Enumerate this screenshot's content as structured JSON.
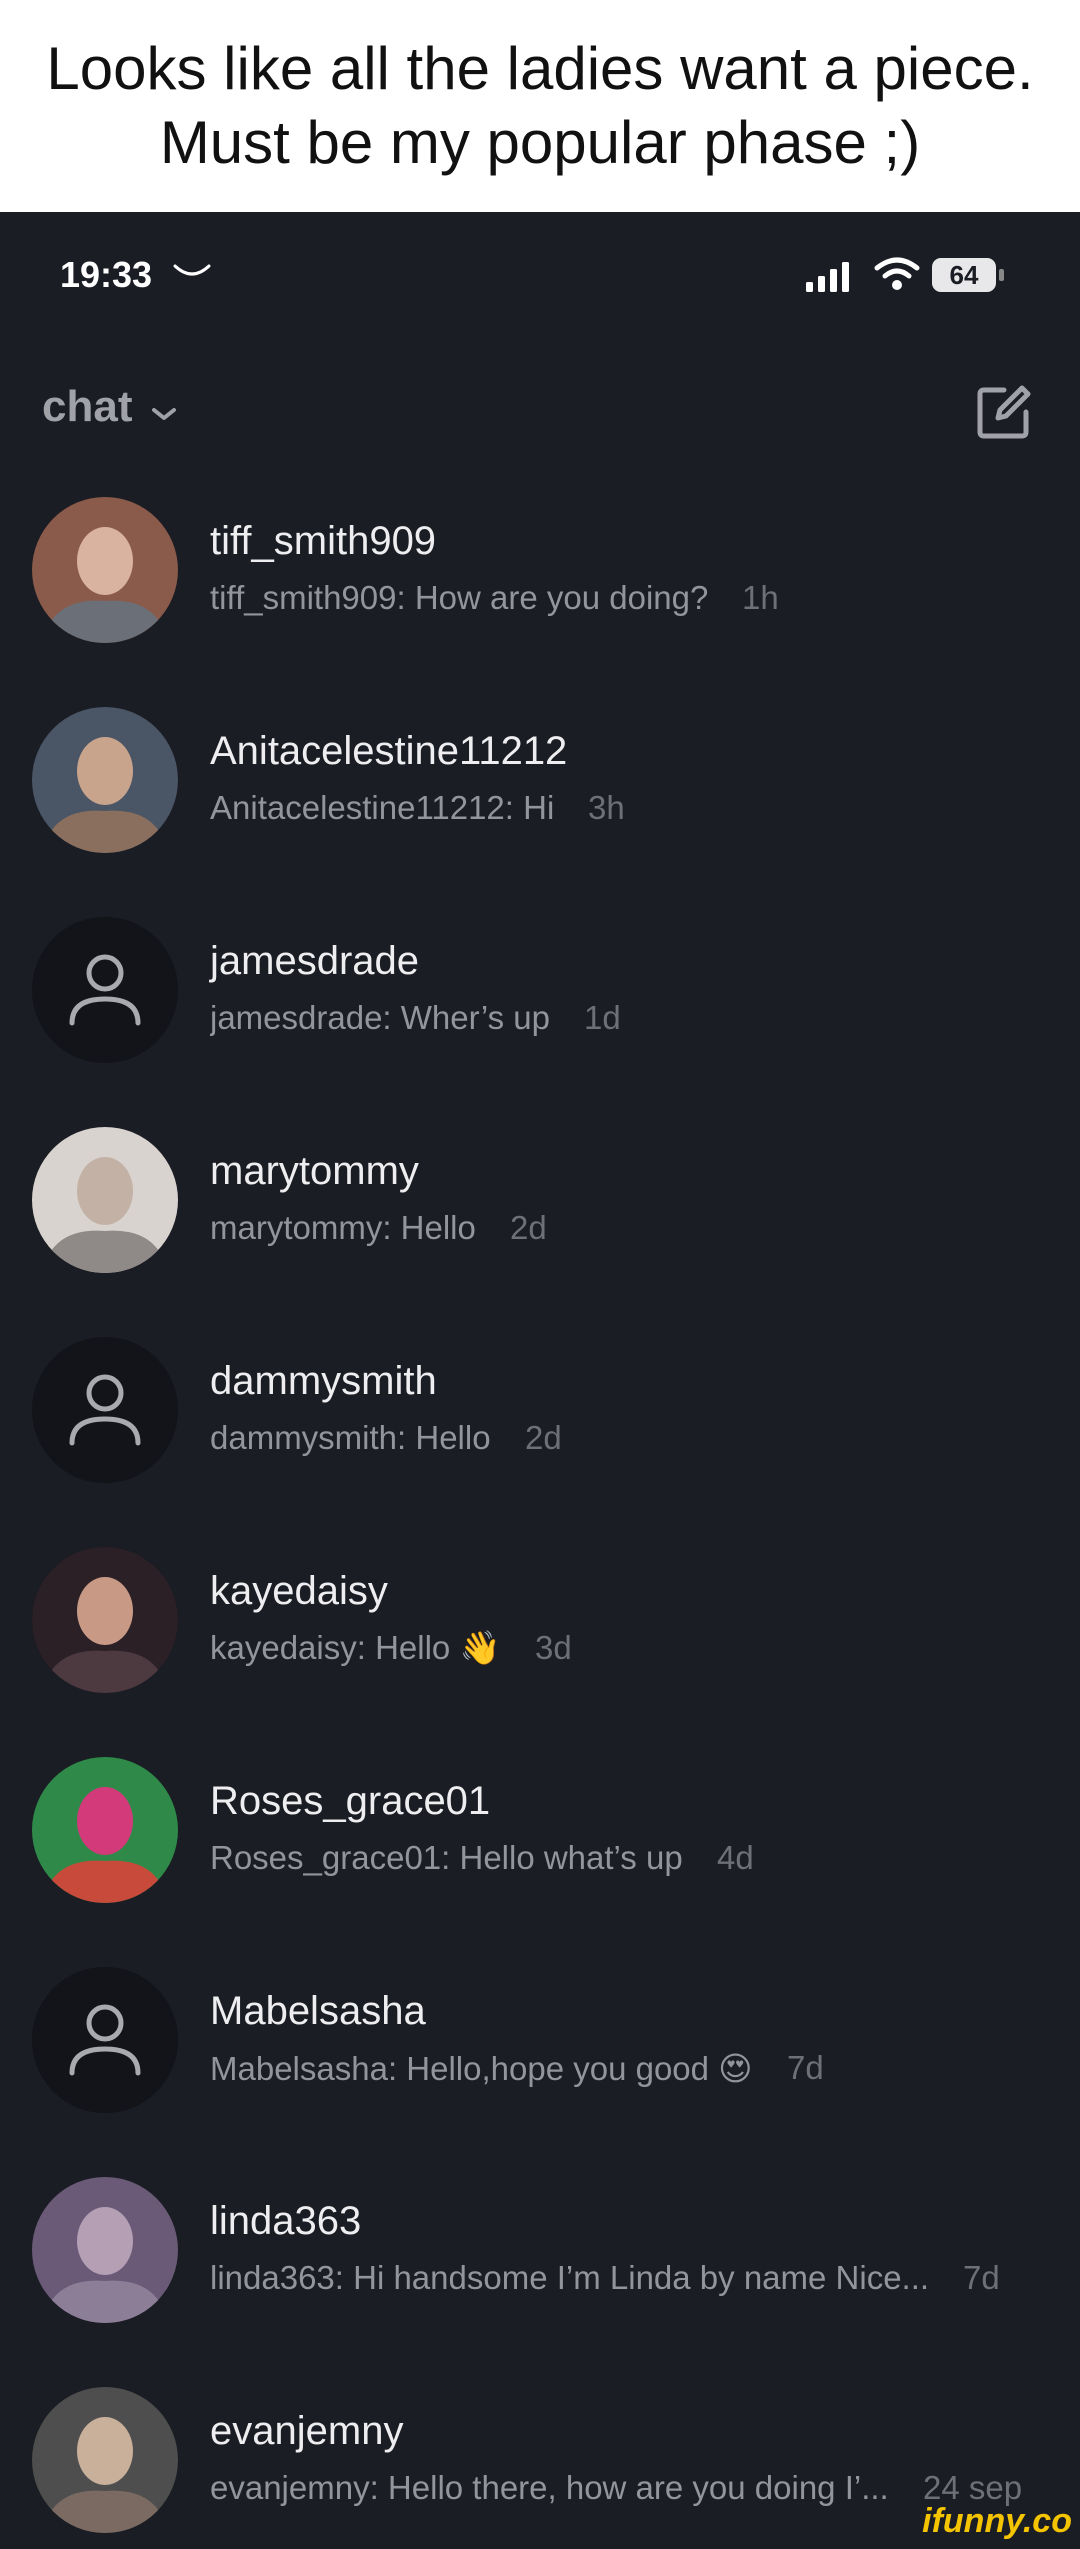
{
  "caption": "Looks like all the ladies want a piece. Must be my popular phase ;)",
  "status": {
    "time": "19:33",
    "battery": "64"
  },
  "header": {
    "title": "chat"
  },
  "chats": [
    {
      "name": "tiff_smith909",
      "preview": "tiff_smith909: How are you doing?",
      "time": "1h",
      "avatar": "photo"
    },
    {
      "name": "Anitacelestine11212",
      "preview": "Anitacelestine11212: Hi",
      "time": "3h",
      "avatar": "photo"
    },
    {
      "name": "jamesdrade",
      "preview": "jamesdrade: Wher’s up",
      "time": "1d",
      "avatar": "default"
    },
    {
      "name": "marytommy",
      "preview": "marytommy: Hello",
      "time": "2d",
      "avatar": "photo"
    },
    {
      "name": "dammysmith",
      "preview": "dammysmith: Hello",
      "time": "2d",
      "avatar": "default"
    },
    {
      "name": "kayedaisy",
      "preview": "kayedaisy: Hello 👋",
      "time": "3d",
      "avatar": "photo"
    },
    {
      "name": "Roses_grace01",
      "preview": "Roses_grace01: Hello what’s up",
      "time": "4d",
      "avatar": "photo"
    },
    {
      "name": "Mabelsasha",
      "preview": "Mabelsasha: Hello,hope you good 😍",
      "time": "7d",
      "avatar": "default"
    },
    {
      "name": "linda363",
      "preview": "linda363: Hi handsome  I’m Linda by name  Nice...",
      "time": "7d",
      "avatar": "photo"
    },
    {
      "name": "evanjemny",
      "preview": "evanjemny: Hello there, how are you doing I’...",
      "time": "24 sep",
      "avatar": "photo"
    }
  ],
  "watermark": "ifunny.co"
}
